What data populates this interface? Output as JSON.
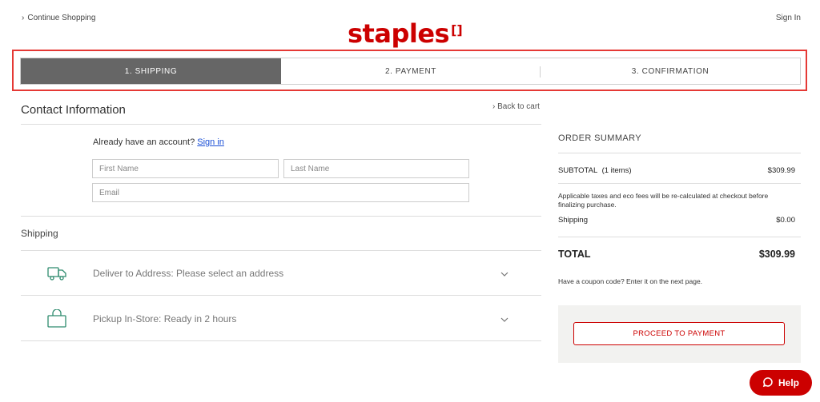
{
  "header": {
    "continue_label": "Continue Shopping",
    "logo_text": "staples",
    "logo_mark": "[]",
    "signin_label": "Sign In"
  },
  "steps": [
    {
      "label": "1. SHIPPING",
      "active": true
    },
    {
      "label": "2. PAYMENT",
      "active": false
    },
    {
      "label": "3. CONFIRMATION",
      "active": false
    }
  ],
  "contact": {
    "title": "Contact Information",
    "back_label": "Back to cart",
    "account_prompt": "Already have an account?",
    "signin_link": "Sign in",
    "first_name_placeholder": "First Name",
    "last_name_placeholder": "Last Name",
    "email_placeholder": "Email"
  },
  "shipping": {
    "title": "Shipping",
    "options": [
      {
        "label": "Deliver to Address: Please select an address",
        "icon": "truck-icon"
      },
      {
        "label": "Pickup In-Store: Ready in 2 hours",
        "icon": "bag-icon"
      }
    ]
  },
  "summary": {
    "title": "ORDER SUMMARY",
    "subtotal_label": "SUBTOTAL",
    "subtotal_count": "(1 items)",
    "subtotal_value": "$309.99",
    "tax_note": "Applicable taxes and eco fees will be re-calculated at checkout before finalizing purchase.",
    "shipping_label": "Shipping",
    "shipping_value": "$0.00",
    "total_label": "TOTAL",
    "total_value": "$309.99",
    "coupon_note": "Have a coupon code? Enter it on the next page.",
    "proceed_label": "PROCEED TO PAYMENT"
  },
  "help": {
    "label": "Help"
  },
  "colors": {
    "brand_red": "#cc0000",
    "active_step": "#666666",
    "icon_green": "#2e8b6e",
    "link_blue": "#1a4fd6"
  }
}
